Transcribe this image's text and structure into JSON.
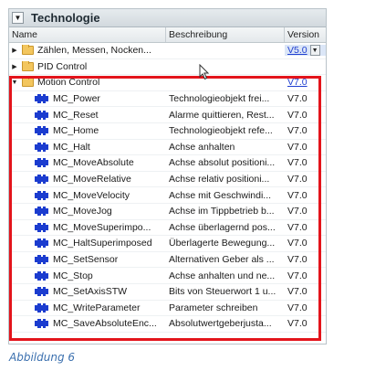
{
  "panel": {
    "title": "Technologie",
    "columns": {
      "name": "Name",
      "description": "Beschreibung",
      "version": "Version"
    }
  },
  "rows": [
    {
      "type": "folder",
      "expanded": false,
      "name": "Zählen, Messen, Nocken...",
      "description": "",
      "version": "V5.0",
      "version_link": true,
      "dropdown": true,
      "selected": true
    },
    {
      "type": "folder",
      "expanded": false,
      "name": "PID Control",
      "description": "",
      "version": "",
      "version_link": false
    },
    {
      "type": "folder",
      "expanded": true,
      "name": "Motion Control",
      "description": "",
      "version": "V7.0",
      "version_link": true
    },
    {
      "type": "tobject",
      "name": "MC_Power",
      "description": "Technologieobjekt frei...",
      "version": "V7.0"
    },
    {
      "type": "tobject",
      "name": "MC_Reset",
      "description": "Alarme quittieren, Rest...",
      "version": "V7.0"
    },
    {
      "type": "tobject",
      "name": "MC_Home",
      "description": "Technologieobjekt refe...",
      "version": "V7.0"
    },
    {
      "type": "tobject",
      "name": "MC_Halt",
      "description": "Achse anhalten",
      "version": "V7.0"
    },
    {
      "type": "tobject",
      "name": "MC_MoveAbsolute",
      "description": "Achse absolut positioni...",
      "version": "V7.0"
    },
    {
      "type": "tobject",
      "name": "MC_MoveRelative",
      "description": "Achse relativ positioni...",
      "version": "V7.0"
    },
    {
      "type": "tobject",
      "name": "MC_MoveVelocity",
      "description": "Achse mit Geschwindi...",
      "version": "V7.0"
    },
    {
      "type": "tobject",
      "name": "MC_MoveJog",
      "description": "Achse im Tippbetrieb b...",
      "version": "V7.0"
    },
    {
      "type": "tobject",
      "name": "MC_MoveSuperimpo...",
      "description": "Achse überlagernd pos...",
      "version": "V7.0"
    },
    {
      "type": "tobject",
      "name": "MC_HaltSuperimposed",
      "description": "Überlagerte Bewegung...",
      "version": "V7.0"
    },
    {
      "type": "tobject",
      "name": "MC_SetSensor",
      "description": "Alternativen Geber als ...",
      "version": "V7.0"
    },
    {
      "type": "tobject",
      "name": "MC_Stop",
      "description": "Achse anhalten und ne...",
      "version": "V7.0"
    },
    {
      "type": "tobject",
      "name": "MC_SetAxisSTW",
      "description": "Bits von Steuerwort 1 u...",
      "version": "V7.0"
    },
    {
      "type": "tobject",
      "name": "MC_WriteParameter",
      "description": "Parameter schreiben",
      "version": "V7.0"
    },
    {
      "type": "tobject",
      "name": "MC_SaveAbsoluteEnc...",
      "description": "Absolutwertgeberjusta...",
      "version": "V7.0"
    }
  ],
  "caption": "Abbildung 6",
  "colors": {
    "highlight": "#e3141b",
    "link": "#1f3fd1",
    "tobject_icon": "#1b3ccf",
    "folder": "#f3c65e"
  },
  "icons": {
    "folder": "folder-icon",
    "tobject": "technology-object-icon",
    "collapse": "collapse-icon",
    "expand": "expand-arrow-icon"
  }
}
